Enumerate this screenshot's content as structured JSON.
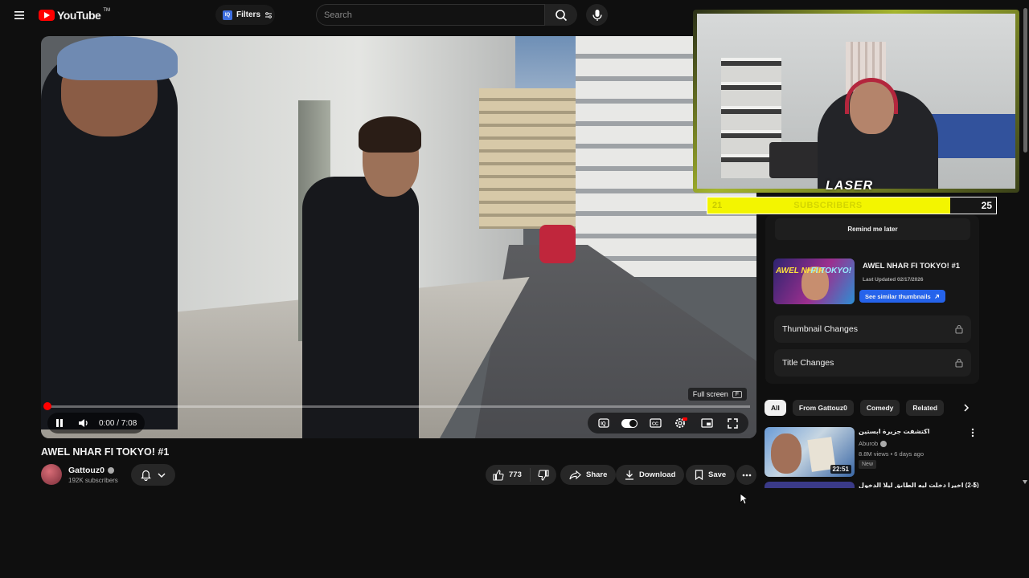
{
  "header": {
    "logo_text": "YouTube",
    "logo_tm": "TM",
    "filters_label": "Filters",
    "search_placeholder": "Search"
  },
  "player": {
    "fullscreen_hint": "Full screen",
    "fullscreen_key": "F",
    "time": "0:00 / 7:08",
    "progress_fraction": 0.0
  },
  "video": {
    "title": "AWEL NHAR FI TOKYO! #1",
    "channel": "Gattouz0",
    "subscribers": "192K subscribers",
    "likes": "773",
    "share_label": "Share",
    "download_label": "Download",
    "save_label": "Save"
  },
  "overlay": {
    "brand": "LASER",
    "sub_start": "21",
    "sub_label": "SUBSCRIBERS",
    "sub_goal": "25",
    "sub_fraction": 0.84,
    "accent": "#f3f500"
  },
  "side_panel": {
    "remind_label": "Remind me later",
    "thumb_title": "AWEL NHAR FI TOKYO! #1",
    "thumb_text_left": "AWEL NHAR",
    "thumb_text_right": "FI TOKYO!",
    "last_updated": "Last Updated 02/17/2026",
    "similar_label": "See similar thumbnails",
    "thumbnail_changes": "Thumbnail Changes",
    "title_changes": "Title Changes"
  },
  "chips": [
    "All",
    "From Gattouz0",
    "Comedy",
    "Related"
  ],
  "recommendations": [
    {
      "title": "اكتشفت جزيرة ابستين",
      "channel": "Aburob",
      "meta": "8.8M views • 6 days ago",
      "badge": "New",
      "duration": "22:51"
    },
    {
      "title": "(2-5) اخيرا دخلت ليه الطابق ليلا الدخول"
    }
  ],
  "colors": {
    "background": "#0f0f0f",
    "accent_red": "#ff0000",
    "link_blue": "#2563eb"
  }
}
